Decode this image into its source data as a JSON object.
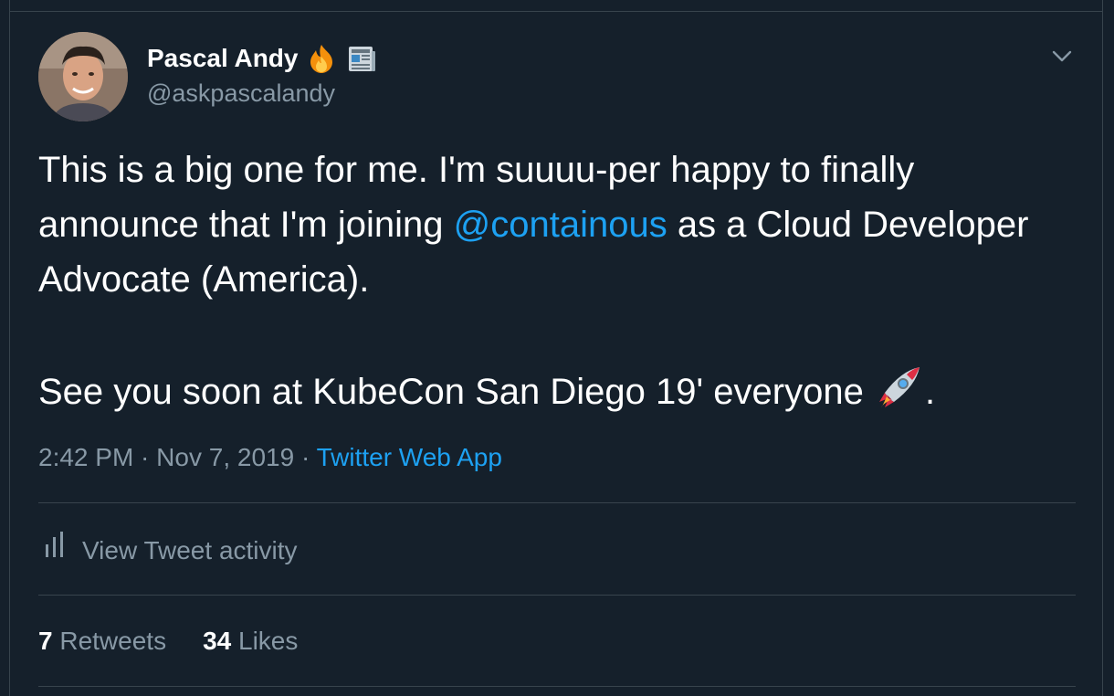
{
  "author": {
    "display_name": "Pascal Andy",
    "handle": "@askpascalandy",
    "badges": [
      "fire-emoji",
      "newspaper-emoji"
    ]
  },
  "tweet": {
    "text_part1": "This is a big one for me. I'm suuuu-per happy to finally announce that I'm joining ",
    "mention": "@containous",
    "text_part2": " as a Cloud Developer Advocate (America).\n\nSee you soon at KubeCon San Diego 19' everyone ",
    "text_part3": ".",
    "emoji": "rocket-emoji"
  },
  "meta": {
    "time": "2:42 PM",
    "separator1": " · ",
    "date": "Nov 7, 2019",
    "separator2": " · ",
    "source": "Twitter Web App"
  },
  "activity": {
    "label": "View Tweet activity",
    "icon": "bar-chart-icon"
  },
  "stats": {
    "retweets_count": "7",
    "retweets_label": "Retweets",
    "likes_count": "34",
    "likes_label": "Likes"
  },
  "colors": {
    "background": "#15202b",
    "border": "#38444d",
    "text": "#ffffff",
    "muted": "#8899a6",
    "accent": "#1da1f2"
  }
}
